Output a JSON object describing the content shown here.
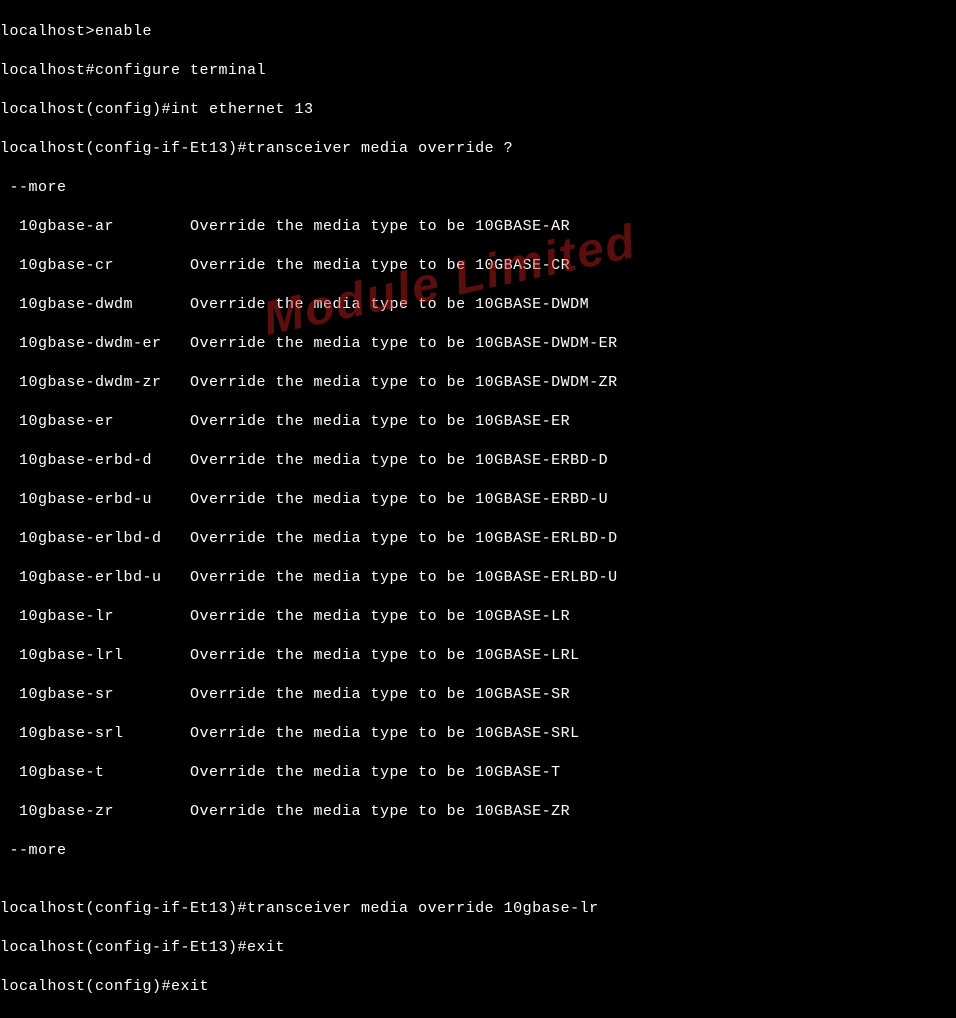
{
  "lines": [
    "localhost>enable",
    "localhost#configure terminal",
    "localhost(config)#int ethernet 13",
    "localhost(config-if-Et13)#transceiver media override ?",
    " --more ",
    "  10gbase-ar        Override the media type to be 10GBASE-AR",
    "  10gbase-cr        Override the media type to be 10GBASE-CR",
    "  10gbase-dwdm      Override the media type to be 10GBASE-DWDM",
    "  10gbase-dwdm-er   Override the media type to be 10GBASE-DWDM-ER",
    "  10gbase-dwdm-zr   Override the media type to be 10GBASE-DWDM-ZR",
    "  10gbase-er        Override the media type to be 10GBASE-ER",
    "  10gbase-erbd-d    Override the media type to be 10GBASE-ERBD-D",
    "  10gbase-erbd-u    Override the media type to be 10GBASE-ERBD-U",
    "  10gbase-erlbd-d   Override the media type to be 10GBASE-ERLBD-D",
    "  10gbase-erlbd-u   Override the media type to be 10GBASE-ERLBD-U",
    "  10gbase-lr        Override the media type to be 10GBASE-LR",
    "  10gbase-lrl       Override the media type to be 10GBASE-LRL",
    "  10gbase-sr        Override the media type to be 10GBASE-SR",
    "  10gbase-srl       Override the media type to be 10GBASE-SRL",
    "  10gbase-t         Override the media type to be 10GBASE-T",
    "  10gbase-zr        Override the media type to be 10GBASE-ZR",
    " --more ",
    "",
    "localhost(config-if-Et13)#transceiver media override 10gbase-lr",
    "localhost(config-if-Et13)#exit",
    "localhost(config)#exit"
  ],
  "watermark": "Module Limited"
}
